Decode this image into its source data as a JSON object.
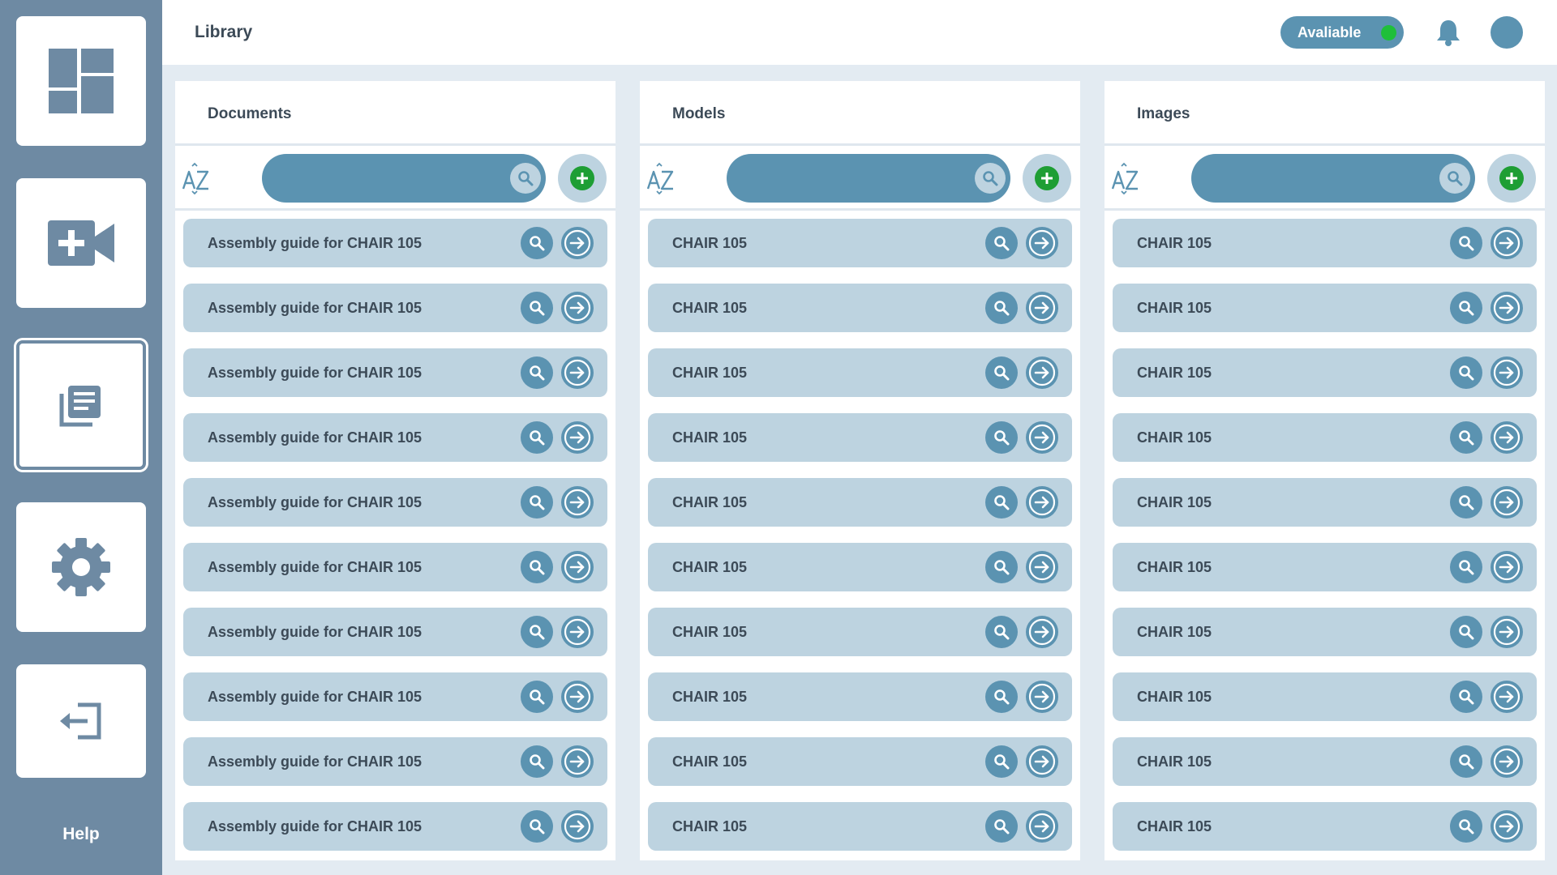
{
  "page": {
    "title": "Library"
  },
  "topbar": {
    "status_label": "Avaliable",
    "status_color": "#1fbf3a"
  },
  "sidebar": {
    "items": [
      {
        "icon": "dashboard-icon"
      },
      {
        "icon": "video-add-icon"
      },
      {
        "icon": "library-icon",
        "active": true
      },
      {
        "icon": "gear-icon"
      },
      {
        "icon": "logout-icon"
      }
    ],
    "help_label": "Help"
  },
  "colors": {
    "accent": "#5b93b1",
    "row": "#bdd3e0",
    "add": "#1e9e34",
    "sidebar": "#6e8aa3"
  },
  "panels": [
    {
      "title": "Documents",
      "sort_label": "A-Z",
      "search_value": "",
      "items": [
        "Assembly guide for CHAIR 105",
        "Assembly guide for CHAIR 105",
        "Assembly guide for CHAIR 105",
        "Assembly guide for CHAIR 105",
        "Assembly guide for CHAIR 105",
        "Assembly guide for CHAIR 105",
        "Assembly guide for CHAIR 105",
        "Assembly guide for CHAIR 105",
        "Assembly guide for CHAIR 105",
        "Assembly guide for CHAIR 105"
      ]
    },
    {
      "title": "Models",
      "sort_label": "A-Z",
      "search_value": "",
      "items": [
        "CHAIR 105",
        "CHAIR 105",
        "CHAIR 105",
        "CHAIR 105",
        "CHAIR 105",
        "CHAIR 105",
        "CHAIR 105",
        "CHAIR 105",
        "CHAIR 105",
        "CHAIR 105"
      ]
    },
    {
      "title": "Images",
      "sort_label": "A-Z",
      "search_value": "",
      "items": [
        "CHAIR 105",
        "CHAIR 105",
        "CHAIR 105",
        "CHAIR 105",
        "CHAIR 105",
        "CHAIR 105",
        "CHAIR 105",
        "CHAIR 105",
        "CHAIR 105",
        "CHAIR 105"
      ]
    }
  ]
}
